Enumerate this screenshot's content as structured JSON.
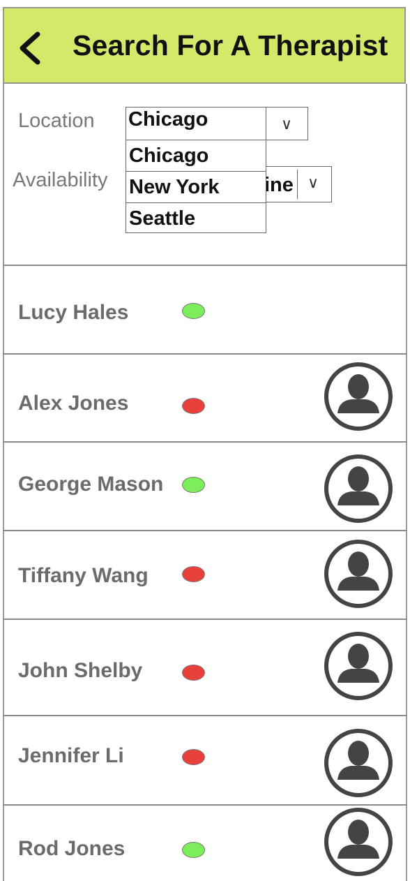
{
  "header": {
    "title": "Search For A Therapist",
    "back_icon": "chevron-left-icon",
    "bg_color": "#d6e86a"
  },
  "filters": {
    "location_label": "Location",
    "location_value": "Chicago",
    "location_options": [
      "Chicago",
      "New York",
      "Seattle"
    ],
    "availability_label": "Availability",
    "availability_value_visible": "ine",
    "arrow_glyph": "∨"
  },
  "status_colors": {
    "available": "#7ded5b",
    "unavailable": "#e8413b"
  },
  "therapists": [
    {
      "name": "Lucy Hales",
      "status": "available",
      "avatar": false
    },
    {
      "name": "Alex Jones",
      "status": "unavailable",
      "avatar": true
    },
    {
      "name": "George Mason",
      "status": "available",
      "avatar": true
    },
    {
      "name": "Tiffany Wang",
      "status": "unavailable",
      "avatar": true
    },
    {
      "name": "John Shelby",
      "status": "unavailable",
      "avatar": true
    },
    {
      "name": "Jennifer Li",
      "status": "unavailable",
      "avatar": true
    },
    {
      "name": "Rod Jones",
      "status": "available",
      "avatar": true
    }
  ]
}
